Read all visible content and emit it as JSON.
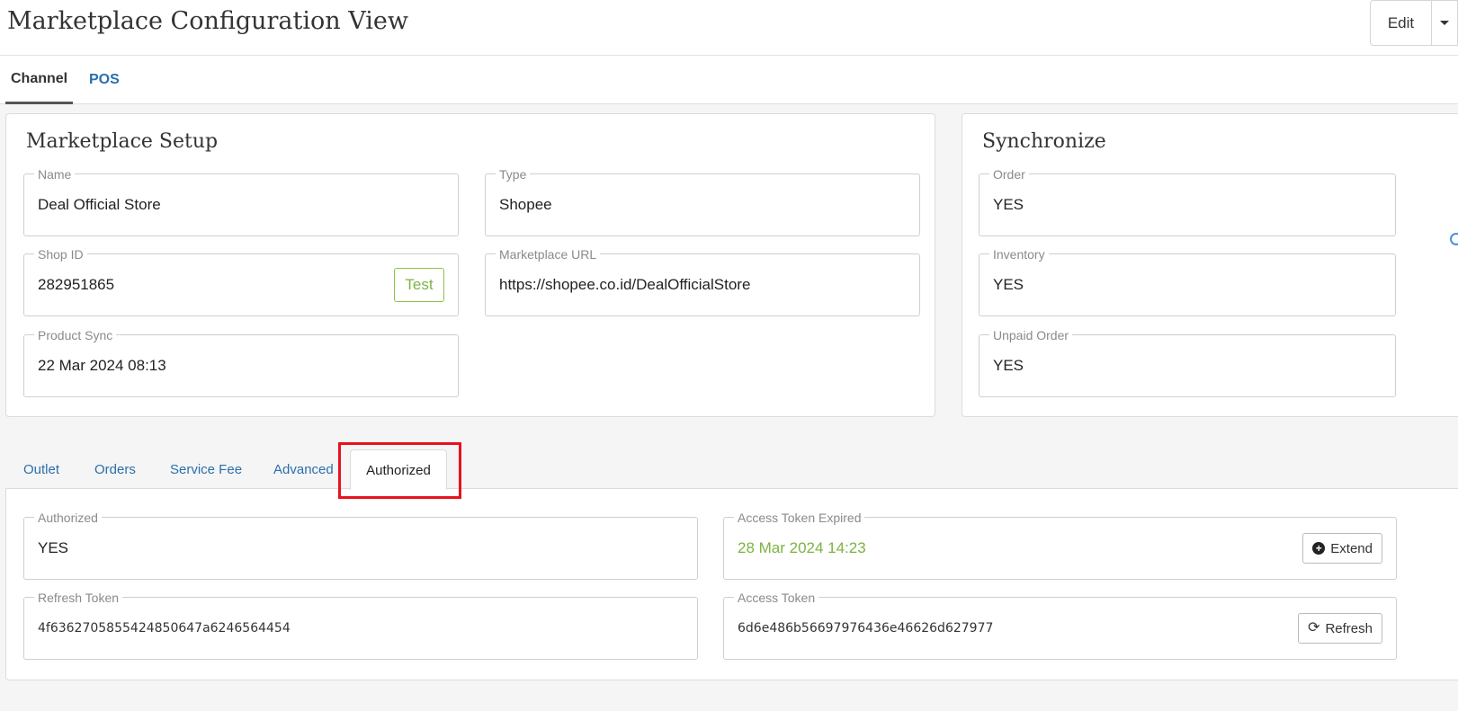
{
  "header": {
    "title": "Marketplace Configuration View",
    "edit_label": "Edit"
  },
  "main_tabs": [
    {
      "label": "Channel"
    },
    {
      "label": "POS"
    }
  ],
  "setup": {
    "title": "Marketplace Setup",
    "name": {
      "label": "Name",
      "value": "Deal Official Store"
    },
    "type": {
      "label": "Type",
      "value": "Shopee"
    },
    "shop_id": {
      "label": "Shop ID",
      "value": "282951865",
      "test_label": "Test"
    },
    "url": {
      "label": "Marketplace URL",
      "value": "https://shopee.co.id/DealOfficialStore"
    },
    "product_sync": {
      "label": "Product Sync",
      "value": "22 Mar 2024 08:13"
    }
  },
  "sync": {
    "title": "Synchronize",
    "order": {
      "label": "Order",
      "value": "YES"
    },
    "inventory": {
      "label": "Inventory",
      "value": "YES"
    },
    "unpaid": {
      "label": "Unpaid Order",
      "value": "YES"
    }
  },
  "sub_tabs": [
    {
      "label": "Outlet"
    },
    {
      "label": "Orders"
    },
    {
      "label": "Service Fee"
    },
    {
      "label": "Advanced"
    },
    {
      "label": "Authorized"
    }
  ],
  "auth": {
    "authorized": {
      "label": "Authorized",
      "value": "YES"
    },
    "expired": {
      "label": "Access Token Expired",
      "value": "28 Mar 2024 14:23",
      "extend_label": "Extend",
      "color": "#7cb342"
    },
    "refresh_token": {
      "label": "Refresh Token",
      "value": "4f6362705855424850647a6246564454"
    },
    "access_token": {
      "label": "Access Token",
      "value": "6d6e486b56697976436e46626d627977",
      "refresh_label": "Refresh"
    }
  },
  "colors": {
    "link": "#2a6fab",
    "highlight": "#e8121c",
    "accent_green": "#7cb342"
  }
}
